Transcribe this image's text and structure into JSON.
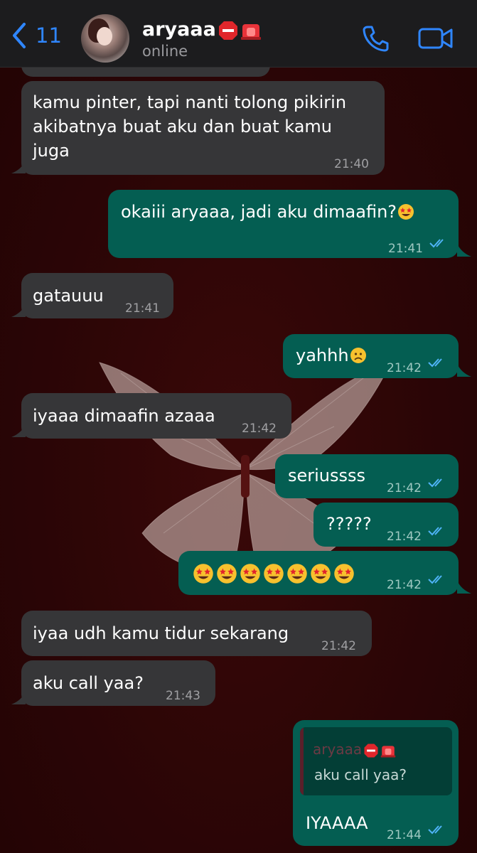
{
  "header": {
    "back_count": "11",
    "contact_name": "aryaaa",
    "status": "online"
  },
  "messages": [
    {
      "text": "kamu pinter, tapi nanti tolong pikirin\nakibatnya buat aku dan buat kamu\njuga",
      "time": "21:40",
      "direction": "incoming"
    },
    {
      "text": "okaiii aryaaa, jadi aku dimaafin?",
      "time": "21:41",
      "direction": "outgoing",
      "read": true
    },
    {
      "text": "gatauuu",
      "time": "21:41",
      "direction": "incoming"
    },
    {
      "text": "yahhh",
      "time": "21:42",
      "direction": "outgoing",
      "read": true
    },
    {
      "text": "iyaaa dimaafin azaaa",
      "time": "21:42",
      "direction": "incoming"
    },
    {
      "text": "seriussss",
      "time": "21:42",
      "direction": "outgoing",
      "read": true
    },
    {
      "text": "?????",
      "time": "21:42",
      "direction": "outgoing",
      "read": true
    },
    {
      "text": "",
      "time": "21:42",
      "direction": "outgoing",
      "read": true,
      "emoji_count": 7
    },
    {
      "text": "iyaa udh kamu tidur sekarang",
      "time": "21:42",
      "direction": "incoming"
    },
    {
      "text": "aku call yaa?",
      "time": "21:43",
      "direction": "incoming"
    },
    {
      "text": "IYAAAA",
      "time": "21:44",
      "direction": "outgoing",
      "read": true,
      "reply": {
        "name": "aryaaa",
        "text": "aku call yaa?"
      }
    }
  ],
  "colors": {
    "accent": "#2f86ff",
    "incoming_bubble": "#363638",
    "outgoing_bubble": "#045e52",
    "read_ticks": "#4fb3f7",
    "background": "#2a0506"
  },
  "icons": [
    "chevron-left-icon",
    "phone-icon",
    "video-camera-icon",
    "double-check-icon",
    "star-struck-emoji",
    "frowning-emoji",
    "stop-sign-emoji",
    "police-light-emoji"
  ]
}
